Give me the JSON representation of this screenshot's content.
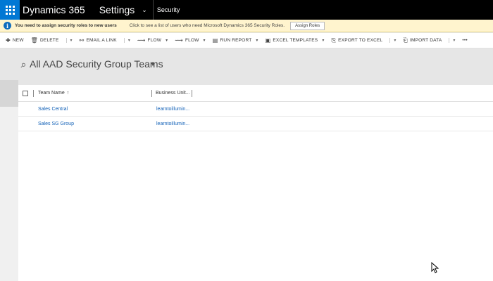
{
  "topbar": {
    "app_title": "Dynamics 365",
    "area": "Settings",
    "breadcrumb": "Security"
  },
  "notification": {
    "strong": "You need to assign security roles to new users",
    "message": "Click to see a list of users who need Microsoft Dynamics 365 Security Roles.",
    "button": "Assign Roles"
  },
  "commands": {
    "new": "NEW",
    "delete": "DELETE",
    "email": "EMAIL A LINK",
    "flow1": "FLOW",
    "flow2": "FLOW",
    "run_report": "RUN REPORT",
    "excel_templates": "EXCEL TEMPLATES",
    "export": "EXPORT TO EXCEL",
    "import": "IMPORT DATA",
    "more": "•••"
  },
  "view": {
    "title": "All AAD Security Group Teams"
  },
  "grid": {
    "columns": [
      "Team Name",
      "Business Unit..."
    ],
    "rows": [
      {
        "name": "Sales Central",
        "bu": "learntoillumin..."
      },
      {
        "name": "Sales SG Group",
        "bu": "learntoillumin..."
      }
    ]
  }
}
